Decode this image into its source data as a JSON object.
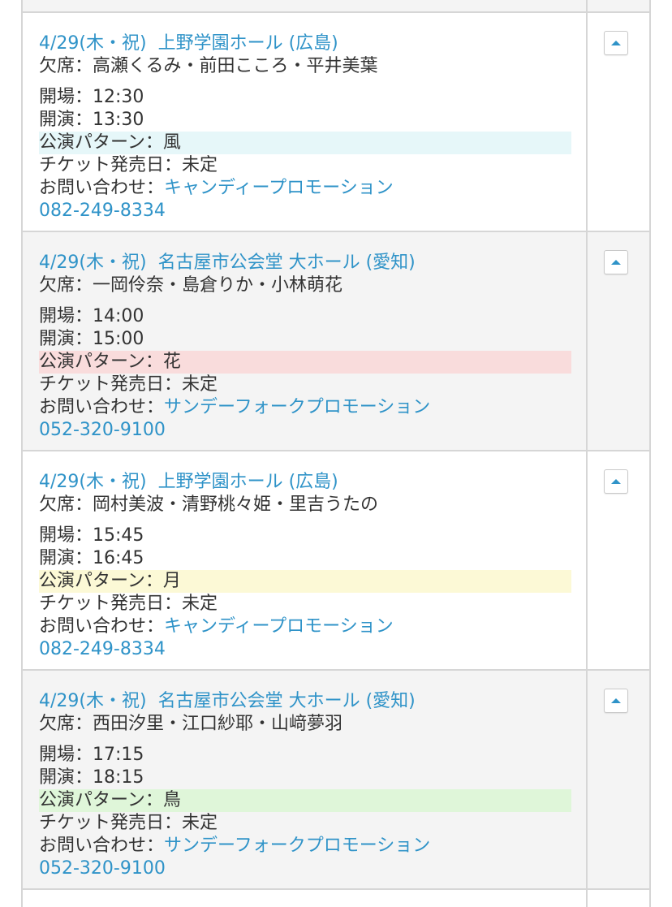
{
  "colors": {
    "link": "#2f93c8",
    "text": "#333333",
    "row_alt": "#f4f4f4",
    "border": "#d6d6d6"
  },
  "events": [
    {
      "date": "4/29(木・祝)",
      "venue": "上野学園ホール (広島)",
      "absent": "欠席：高瀬くるみ・前田こころ・平井美葉",
      "open": "開場：12:30",
      "start": "開演：13:30",
      "pattern": "公演パターン：風",
      "pattern_color": "#e6f7f9",
      "ticket": "チケット発売日：未定",
      "contact_label": "お問い合わせ：",
      "contact_name": "キャンディープロモーション",
      "phone": "082-249-8334",
      "icon": "triangle-up-icon"
    },
    {
      "date": "4/29(木・祝)",
      "venue": "名古屋市公会堂 大ホール (愛知)",
      "absent": "欠席：一岡伶奈・島倉りか・小林萌花",
      "open": "開場：14:00",
      "start": "開演：15:00",
      "pattern": "公演パターン：花",
      "pattern_color": "#f9dcdc",
      "ticket": "チケット発売日：未定",
      "contact_label": "お問い合わせ：",
      "contact_name": "サンデーフォークプロモーション",
      "phone": "052-320-9100",
      "icon": "triangle-up-icon"
    },
    {
      "date": "4/29(木・祝)",
      "venue": "上野学園ホール (広島)",
      "absent": "欠席：岡村美波・清野桃々姫・里吉うたの",
      "open": "開場：15:45",
      "start": "開演：16:45",
      "pattern": "公演パターン：月",
      "pattern_color": "#fcf9d6",
      "ticket": "チケット発売日：未定",
      "contact_label": "お問い合わせ：",
      "contact_name": "キャンディープロモーション",
      "phone": "082-249-8334",
      "icon": "triangle-up-icon"
    },
    {
      "date": "4/29(木・祝)",
      "venue": "名古屋市公会堂 大ホール (愛知)",
      "absent": "欠席：西田汐里・江口紗耶・山﨑夢羽",
      "open": "開場：17:15",
      "start": "開演：18:15",
      "pattern": "公演パターン：鳥",
      "pattern_color": "#dff6d9",
      "ticket": "チケット発売日：未定",
      "contact_label": "お問い合わせ：",
      "contact_name": "サンデーフォークプロモーション",
      "phone": "052-320-9100",
      "icon": "triangle-up-icon"
    }
  ]
}
